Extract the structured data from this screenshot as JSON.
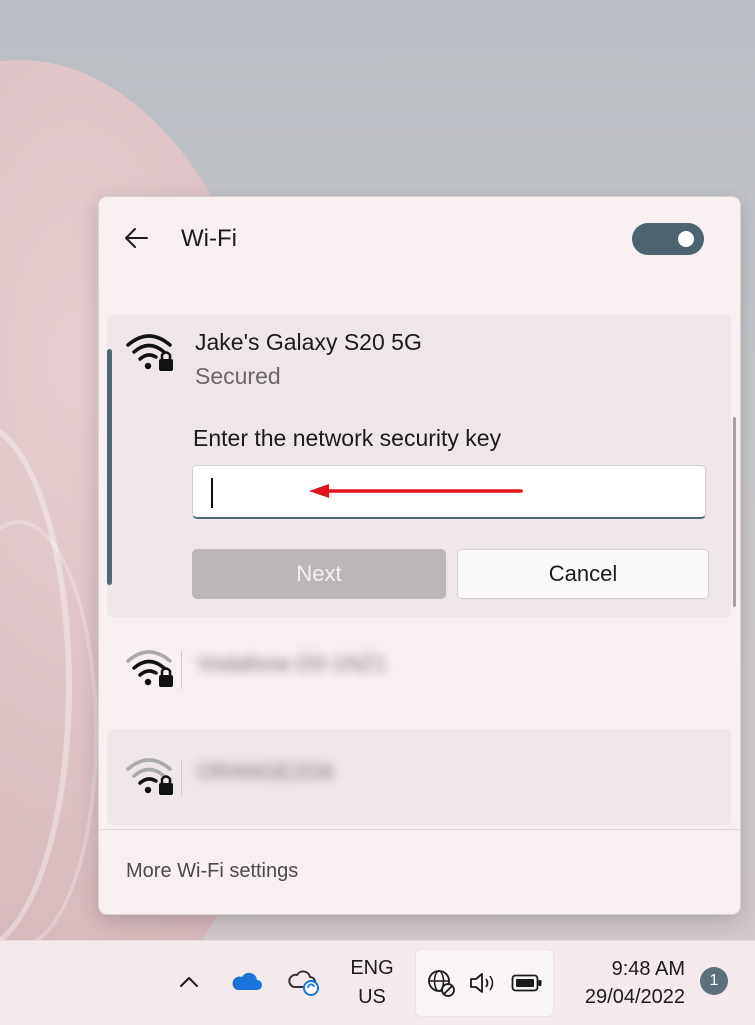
{
  "panel": {
    "title": "Wi-Fi",
    "toggle_state": "on",
    "selected_network": {
      "name": "Jake's Galaxy S20 5G",
      "status": "Secured",
      "key_label": "Enter the network security key",
      "key_value": "",
      "next_label": "Next",
      "cancel_label": "Cancel"
    },
    "other_networks": [
      {
        "name": "Vodafone-D0-1NZ1"
      },
      {
        "name": "ORANGE2G6"
      }
    ],
    "more_settings": "More Wi-Fi settings"
  },
  "taskbar": {
    "language_line1": "ENG",
    "language_line2": "US",
    "time": "9:48 AM",
    "date": "29/04/2022",
    "notification_count": "1"
  },
  "colors": {
    "accent": "#4d6470",
    "annotation_arrow": "#e0141b"
  }
}
